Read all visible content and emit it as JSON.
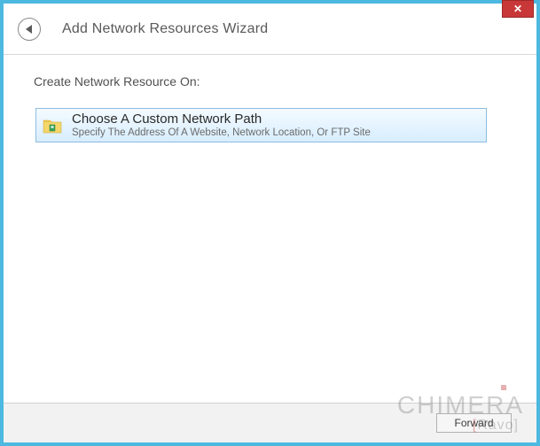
{
  "window": {
    "title": "Add Network Resources Wizard",
    "close_symbol": "✕"
  },
  "content": {
    "section_label": "Create Network Resource On:",
    "option": {
      "title": "Choose A Custom Network Path",
      "description": "Specify The Address Of A Website, Network Location, Or FTP Site"
    }
  },
  "footer": {
    "forward_label": "Forward"
  },
  "watermark": {
    "main": "CHIMERA",
    "sub": "Ravo"
  }
}
